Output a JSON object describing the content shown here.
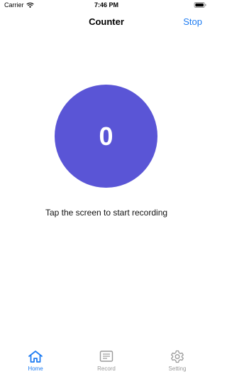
{
  "status_bar": {
    "carrier": "Carrier",
    "time": "7:46 PM",
    "wifi_icon": "wifi-icon",
    "battery_icon": "battery-icon"
  },
  "nav": {
    "title": "Counter",
    "stop_label": "Stop"
  },
  "counter": {
    "value": "0",
    "hint": "Tap the screen to start recording",
    "color": "#5a55d6"
  },
  "tabbar": {
    "tabs": [
      {
        "label": "Home",
        "icon": "home-icon",
        "active": true
      },
      {
        "label": "Record",
        "icon": "record-icon",
        "active": false
      },
      {
        "label": "Setting",
        "icon": "gear-icon",
        "active": false
      }
    ],
    "active_color": "#1e7cf2",
    "inactive_color": "#9a9a9a"
  }
}
